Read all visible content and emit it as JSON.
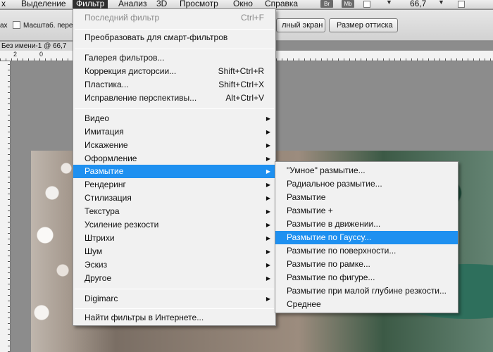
{
  "menubar": {
    "items": [
      "х",
      "Выделение",
      "Фильтр",
      "Анализ",
      "3D",
      "Просмотр",
      "Окно",
      "Справка"
    ],
    "icons": [
      "Br",
      "Mb"
    ],
    "zoom": "66,7"
  },
  "options": {
    "left_fragment": "ах",
    "scale_label": "Масштаб. пере",
    "fullscreen_btn": "лный экран",
    "print_size_btn": "Размер оттиска"
  },
  "document": {
    "tab_title": "Без имени-1 @ 66,7",
    "ruler_numbers": [
      "2",
      "0"
    ]
  },
  "filter_menu": {
    "items": [
      {
        "label": "Последний фильтр",
        "shortcut": "Ctrl+F",
        "disabled": true
      },
      {
        "label": "Преобразовать для смарт-фильтров"
      },
      {
        "label": "Галерея фильтров..."
      },
      {
        "label": "Коррекция дисторсии...",
        "shortcut": "Shift+Ctrl+R"
      },
      {
        "label": "Пластика...",
        "shortcut": "Shift+Ctrl+X"
      },
      {
        "label": "Исправление перспективы...",
        "shortcut": "Alt+Ctrl+V"
      },
      {
        "label": "Видео"
      },
      {
        "label": "Имитация"
      },
      {
        "label": "Искажение"
      },
      {
        "label": "Оформление"
      },
      {
        "label": "Размытие"
      },
      {
        "label": "Рендеринг"
      },
      {
        "label": "Стилизация"
      },
      {
        "label": "Текстура"
      },
      {
        "label": "Усиление резкости"
      },
      {
        "label": "Штрихи"
      },
      {
        "label": "Шум"
      },
      {
        "label": "Эскиз"
      },
      {
        "label": "Другое"
      },
      {
        "label": "Digimarc"
      },
      {
        "label": "Найти фильтры в Интернете..."
      }
    ]
  },
  "blur_menu": {
    "items": [
      {
        "label": "\"Умное\" размытие..."
      },
      {
        "label": "Радиальное размытие..."
      },
      {
        "label": "Размытие"
      },
      {
        "label": "Размытие +"
      },
      {
        "label": "Размытие в движении..."
      },
      {
        "label": "Размытие по Гауссу..."
      },
      {
        "label": "Размытие по поверхности..."
      },
      {
        "label": "Размытие по рамке..."
      },
      {
        "label": "Размытие по фигуре..."
      },
      {
        "label": "Размытие при малой глубине резкости..."
      },
      {
        "label": "Среднее"
      }
    ]
  },
  "colors": {
    "highlight": "#1e90f0",
    "menu_bg": "#f1f1f1",
    "active_menubar": "#2f2f2f"
  }
}
